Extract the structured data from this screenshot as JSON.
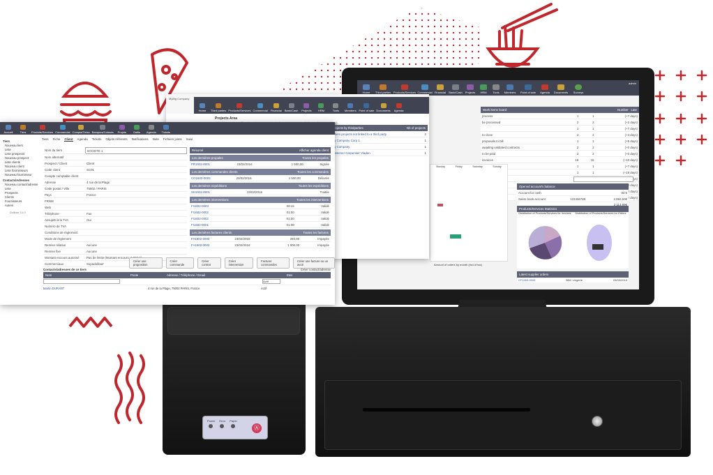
{
  "colors": {
    "accent": "#c0272d",
    "nav": "#3f4352",
    "header": "#5b6075",
    "link": "#2a57a4"
  },
  "main": {
    "brand": "Dolibarr 3.4.0",
    "top_tabs": [
      "Accueil",
      "Tiers",
      "Produits/Services",
      "Commercial",
      "Compta/Tréso",
      "Banques/Caisses",
      "Projets",
      "Outils",
      "Agenda",
      "Tickets"
    ],
    "sidebar": [
      "Tiers",
      "Nouveau tiers",
      "Liste",
      "Liste prospects",
      "Nouveau prospect",
      "Liste clients",
      "Nouveau client",
      "Liste fournisseurs",
      "Nouveau fournisseur",
      "Contacts/Adresses",
      "Nouveau contact/adresse",
      "Liste",
      "Prospects",
      "Clients",
      "Fournisseurs",
      "Autres"
    ],
    "subtabs": [
      "Tiers",
      "Fiche",
      "Client",
      "Agenda",
      "Tickets",
      "Objets référents",
      "Notifications",
      "Note",
      "Fichiers joints",
      "Suivi"
    ],
    "fields": [
      [
        "Nom du tiers",
        "SOCIETE 1"
      ],
      [
        "Nom alternatif",
        ""
      ],
      [
        "Prospect / Client",
        "Client"
      ],
      [
        "Code client",
        "SC01"
      ],
      [
        "Compte comptable client",
        ""
      ],
      [
        "Adresse",
        "4 rue de la Plage"
      ],
      [
        "Code postal / Ville",
        "75002 / PARIS"
      ],
      [
        "Pays",
        "France"
      ],
      [
        "FRNM",
        ""
      ],
      [
        "Web",
        ""
      ],
      [
        "Téléphone",
        "Fax"
      ],
      [
        "Assujetti à la TVA",
        "Oui"
      ],
      [
        "Numéro de TVA",
        ""
      ],
      [
        "Conditions de règlement",
        ""
      ],
      [
        "Mode de règlement",
        ""
      ],
      [
        "Remise relative",
        "Aucune"
      ],
      [
        "Remise fixe",
        "Aucune"
      ],
      [
        "Montant encours autorisé",
        "Pas de limite (Montant encours: 3 050 €)"
      ],
      [
        "Commerciaux",
        "Supadolibarr"
      ]
    ],
    "summary_title": "Résumé",
    "summary_link": "Afficher agenda client",
    "blocks": [
      {
        "title": "Les dernières propales",
        "link": "Toutes les propales",
        "rows": [
          [
            "PR1602-0001",
            "23/02/2016",
            "1 500,00",
            "Signée"
          ]
        ]
      },
      {
        "title": "Les dernières commandes clients",
        "link": "Toutes les commandes",
        "rows": [
          [
            "CO1602-0003",
            "23/02/2016",
            "1 500,00",
            "Délivrée"
          ]
        ]
      },
      {
        "title": "Les dernières expéditions",
        "link": "Toutes les expéditions",
        "rows": [
          [
            "SH1602-0001",
            "23/02/2016",
            "",
            "Traitée"
          ]
        ]
      },
      {
        "title": "Les dernières interventions",
        "link": "Toutes les interventions",
        "rows": [
          [
            "FI1602-0003",
            "",
            "00:15",
            "Validé"
          ],
          [
            "FI1602-0002",
            "",
            "01:00",
            "Validé"
          ],
          [
            "FI1602-0002",
            "",
            "01:00",
            "Validé"
          ],
          [
            "FI1602-0001",
            "",
            "01:00",
            "Validé"
          ]
        ]
      },
      {
        "title": "Les dernières factures clients",
        "link": "Toutes les factures",
        "rows": [
          [
            "FA1602-0003",
            "23/02/2016",
            "250,00",
            "Impayée"
          ],
          [
            "FA1602-0003",
            "23/02/2016",
            "1 000,00",
            "Impayée"
          ]
        ]
      }
    ],
    "buttons": [
      "Créer une proposition",
      "Créer commande",
      "Créer contrat",
      "Créer intervention",
      "Facturer commandes",
      "Créer une facture ou un avoir"
    ],
    "contacts_title": "Contacts/adresses de ce tiers",
    "contacts_link": "Créer contact/adresse",
    "contact_cols": [
      "Nom",
      "Poste",
      "Adresse / Téléphone / Email",
      "Etat"
    ],
    "contact_filter": "Actif",
    "contact_row": [
      "Martin DURANT",
      "",
      "4 rue de la Plage, 75002 PARIS, France",
      "Actif"
    ]
  },
  "projects": {
    "company": "MyBig Company",
    "tabs": [
      "Home",
      "Third parties",
      "Products/Services",
      "Commercial",
      "Financial",
      "Bank/Cash",
      "Projects",
      "HRM",
      "Tools",
      "Members",
      "Point of sale",
      "Documents",
      "Agenda"
    ],
    "title": "Projects Area",
    "desc": "This view presents all projects (your user permissions grant you permission to view everything).",
    "col1": "Projects by thirdparties",
    "col2": "Nb of projects",
    "rows": [
      [
        "Others projects not linked to a third party",
        "2"
      ],
      [
        "Big Company Corp 1",
        "1"
      ],
      [
        "Big Company",
        "1"
      ],
      [
        "Customer Carpentier Vladen",
        "1"
      ]
    ]
  },
  "dashboard": {
    "user": "admin",
    "tabs": [
      "Home",
      "Third parties",
      "Products/Services",
      "Commercial",
      "Financial",
      "Bank/Cash",
      "Projects",
      "HRM",
      "Tools",
      "Members",
      "Point of sale",
      "Agenda",
      "Documents",
      "Surveys"
    ],
    "box1": "Work items board",
    "col_number": "Number",
    "col_late": "Late",
    "rows": [
      [
        "process",
        "1",
        "1",
        "(+7 days)"
      ],
      [
        "be processed",
        "2",
        "2",
        "(+2 days)"
      ],
      [
        "",
        "1",
        "1",
        "(+7 days)"
      ],
      [
        "to close",
        "2",
        "2",
        "(+4 days)"
      ],
      [
        "proposals to bill",
        "1",
        "1",
        "(+5 days)"
      ],
      [
        "awaiting validated contracts",
        "2",
        "2",
        "(+0 days)"
      ],
      [
        "to be paid",
        "2",
        "2",
        "(+0 days)"
      ],
      [
        "invoices",
        "18",
        "15",
        "(+10 days)"
      ],
      [
        "close",
        "1",
        "1",
        "(+7 days)"
      ],
      [
        "close",
        "1",
        "1",
        "(+15 days)"
      ],
      [
        "to be paid",
        "2",
        "2",
        "(+10 days)"
      ],
      [
        "deposit",
        "1",
        "1",
        "(+0 days)"
      ],
      [
        "deposit",
        "2",
        "1",
        "(+0 days)"
      ],
      [
        "option to receive",
        "1",
        "1",
        "(+2 days)"
      ]
    ],
    "open_accounts": "Opened account's balance",
    "accounts": [
      [
        "Account for cash",
        "",
        "93 €"
      ],
      [
        "Swiss bank account",
        "123456789",
        "2 050,50€"
      ]
    ],
    "total": "2 113,69€",
    "dist_title": "Products/Services Statistics",
    "dist_labels": [
      "Distribution of Products/Services for Invoices",
      "Distribution of Products/Services for Orders"
    ],
    "pie_labels": [
      "PRD",
      ""
    ],
    "calendar_days": [
      "Monday",
      "Friday",
      "Saturday",
      "Sunday"
    ],
    "calendar_nav": "Le 2016",
    "amount_chart": "Amount of orders by month (incl of tax)",
    "recent": "Latest supplier orders",
    "recent_rows": [
      [
        "CF1303-0004",
        "BBC Lingerie",
        "03/03/2013"
      ]
    ],
    "btn_refresh": "Refresh"
  },
  "printer": {
    "labels": [
      "Power",
      "Error",
      "Paper"
    ],
    "logo": "Ⓐ"
  }
}
